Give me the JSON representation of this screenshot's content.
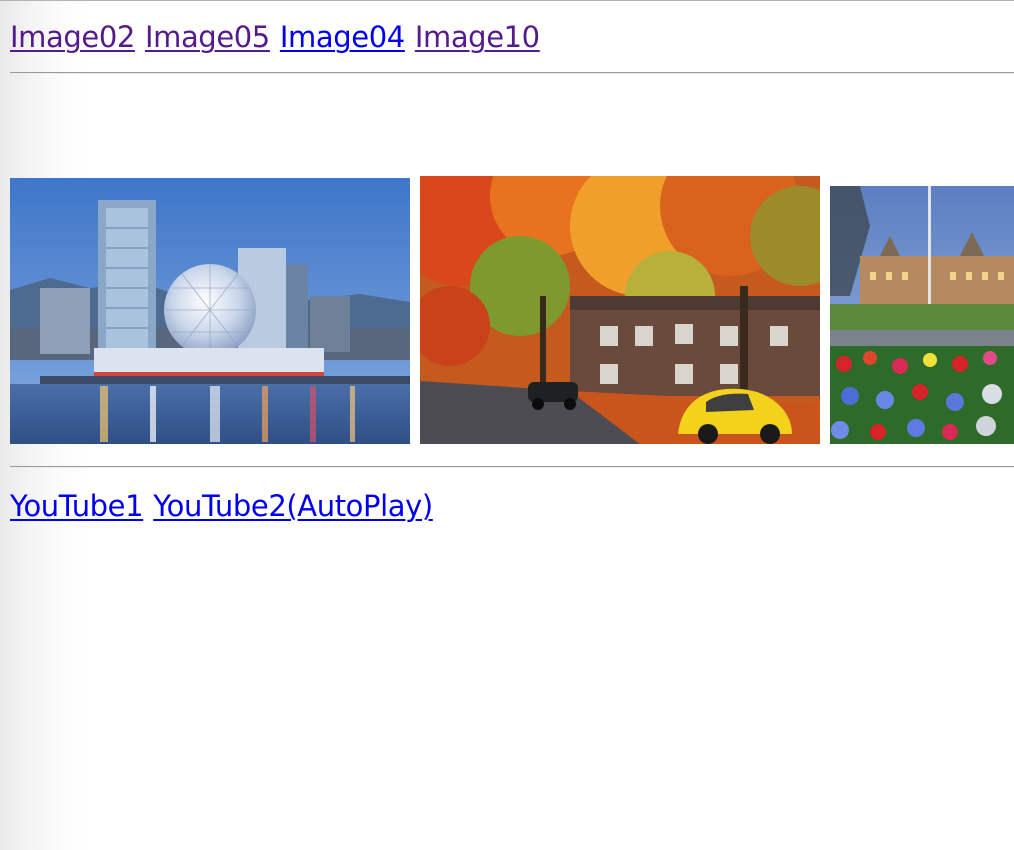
{
  "image_links": [
    {
      "label": "Image02",
      "state": "visited"
    },
    {
      "label": "Image05",
      "state": "visited"
    },
    {
      "label": "Image04",
      "state": "unvisited"
    },
    {
      "label": "Image10",
      "state": "visited"
    }
  ],
  "video_links": [
    {
      "label": "YouTube1",
      "state": "unvisited"
    },
    {
      "label": "YouTube2(AutoPlay)",
      "state": "unvisited"
    }
  ],
  "photos": [
    {
      "subject": "city-skyline-geodesic-dome-waterfront-at-dusk"
    },
    {
      "subject": "autumn-tree-lined-street-with-yellow-beetle-car"
    },
    {
      "subject": "parliament-building-with-flower-garden-at-dusk"
    }
  ],
  "colors": {
    "link_visited": "#551a8b",
    "link_unvisited": "#0000ee"
  }
}
